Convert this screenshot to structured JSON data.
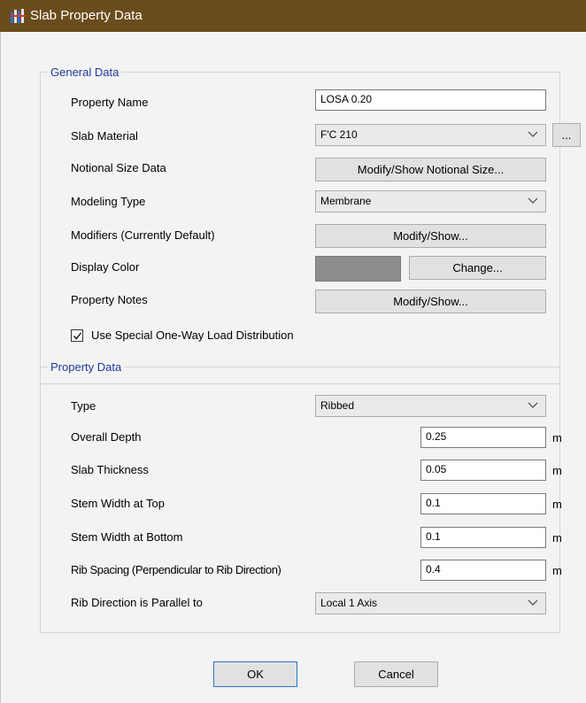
{
  "window": {
    "title": "Slab Property Data",
    "icon": "slab-app-icon"
  },
  "general": {
    "legend": "General Data",
    "property_name": {
      "label": "Property Name",
      "value": "LOSA 0.20"
    },
    "slab_material": {
      "label": "Slab Material",
      "value": "F'C 210",
      "more_label": "..."
    },
    "notional_size": {
      "label": "Notional Size Data",
      "button": "Modify/Show Notional Size..."
    },
    "modeling_type": {
      "label": "Modeling Type",
      "value": "Membrane"
    },
    "modifiers": {
      "label": "Modifiers (Currently Default)",
      "button": "Modify/Show..."
    },
    "display_color": {
      "label": "Display Color",
      "button": "Change...",
      "color": "#8d8d8d"
    },
    "property_notes": {
      "label": "Property Notes",
      "button": "Modify/Show..."
    },
    "one_way": {
      "label": "Use Special One-Way Load Distribution",
      "checked": true
    }
  },
  "property": {
    "legend": "Property Data",
    "type": {
      "label": "Type",
      "value": "Ribbed"
    },
    "overall_depth": {
      "label": "Overall Depth",
      "value": "0.25",
      "unit": "m"
    },
    "slab_thickness": {
      "label": "Slab Thickness",
      "value": "0.05",
      "unit": "m"
    },
    "stem_top": {
      "label": "Stem Width at Top",
      "value": "0.1",
      "unit": "m"
    },
    "stem_bottom": {
      "label": "Stem Width at Bottom",
      "value": "0.1",
      "unit": "m"
    },
    "rib_spacing": {
      "label": "Rib Spacing (Perpendicular to Rib Direction)",
      "value": "0.4",
      "unit": "m"
    },
    "rib_direction": {
      "label": "Rib Direction is Parallel to",
      "value": "Local 1 Axis"
    }
  },
  "buttons": {
    "ok": "OK",
    "cancel": "Cancel"
  },
  "colors": {
    "titlebar": "#6b4c1c",
    "legend": "#1f3a9a",
    "swatch": "#8d8d8d"
  }
}
